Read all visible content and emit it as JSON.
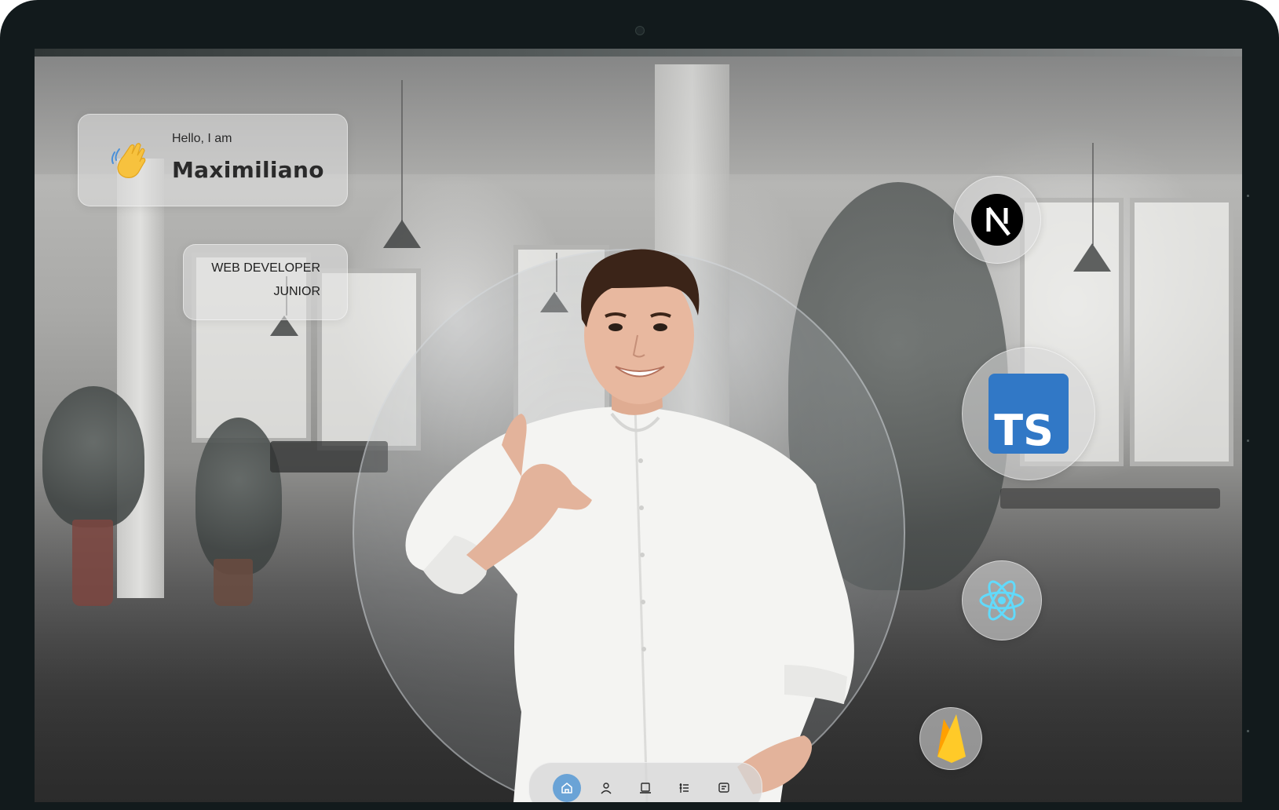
{
  "hero": {
    "greeting": "Hello, I am",
    "name": "Maximiliano",
    "role_line1": "WEB DEVELOPER",
    "role_line2": "JUNIOR",
    "wave_icon": "waving-hand-icon"
  },
  "tech_stack": [
    {
      "name": "Next.js",
      "icon": "nextjs-icon"
    },
    {
      "name": "TypeScript",
      "icon": "typescript-icon",
      "badge_text": "TS",
      "color": "#3178c6"
    },
    {
      "name": "React",
      "icon": "react-icon",
      "color": "#61dafb"
    },
    {
      "name": "Firebase",
      "icon": "firebase-icon",
      "color": "#ffa611"
    }
  ],
  "bottom_nav": {
    "items": [
      {
        "name": "home",
        "icon": "home-icon",
        "active": true
      },
      {
        "name": "about",
        "icon": "user-icon",
        "active": false
      },
      {
        "name": "portfolio",
        "icon": "laptop-icon",
        "active": false
      },
      {
        "name": "experience",
        "icon": "list-icon",
        "active": false
      },
      {
        "name": "contact",
        "icon": "message-icon",
        "active": false
      }
    ],
    "active_color": "#6aa3d6"
  }
}
